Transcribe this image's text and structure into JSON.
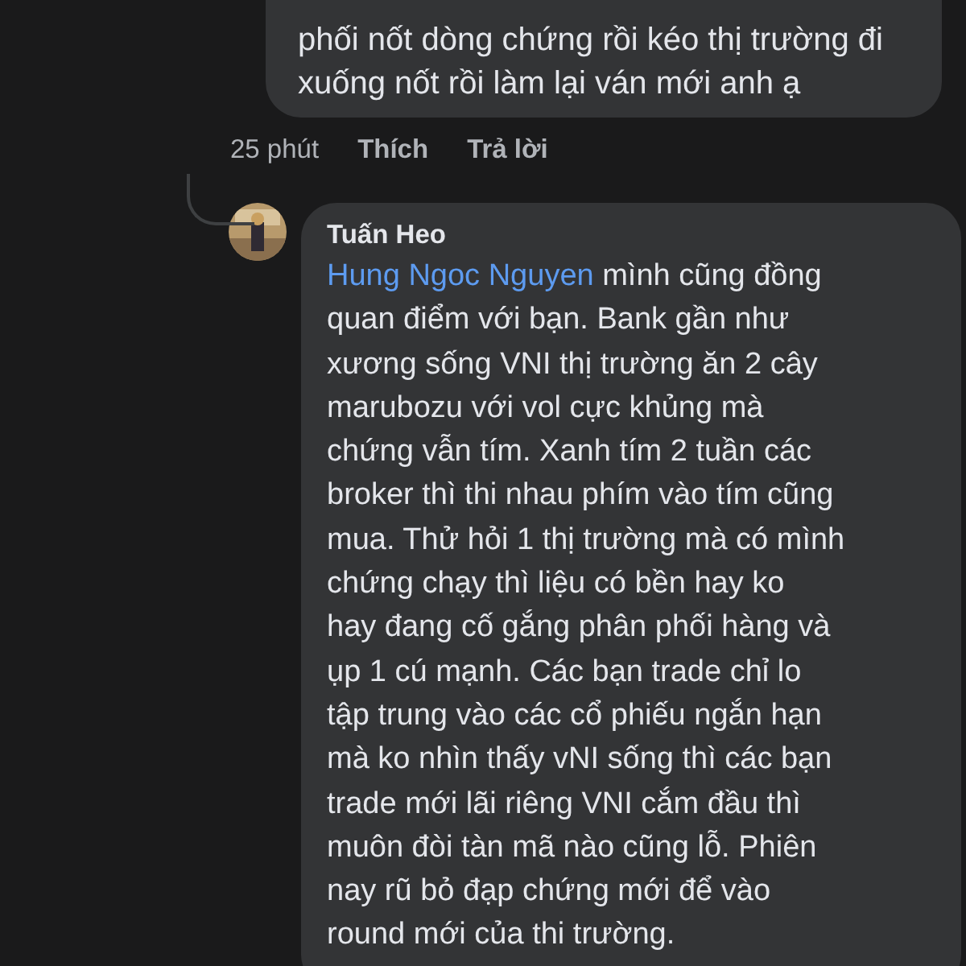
{
  "previous_comment": {
    "text": "phối nốt dòng chứng rồi kéo thị trường đi\nxuống nốt rồi làm lại ván mới anh ạ",
    "time": "25 phút",
    "actions": [
      "Thích",
      "Trả lời"
    ]
  },
  "reply": {
    "author": "Tuấn Heo",
    "mention": "Hung Ngoc Nguyen",
    "text": " mình cũng đồng\nquan điểm với bạn. Bank gần như\nxương sống VNI thị trường ăn 2 cây\nmarubozu với vol cực khủng mà\nchứng vẫn tím. Xanh tím 2 tuần các\nbroker thì thi nhau phím vào tím cũng\nmua. Thử hỏi 1 thị trường mà có mình\nchứng chạy thì liệu có bền hay ko\nhay đang cố gắng phân phối hàng và\nụp 1 cú mạnh. Các bạn trade chỉ lo\ntập trung vào các cổ phiếu ngắn hạn\nmà ko nhìn thấy vNI sống thì các bạn\ntrade mới lãi riêng VNI cắm đầu thì\nmuôn đòi tàn mã nào cũng lỗ. Phiên\nnay rũ bỏ đạp chứng mới để vào\nround mới của thi trường."
  }
}
